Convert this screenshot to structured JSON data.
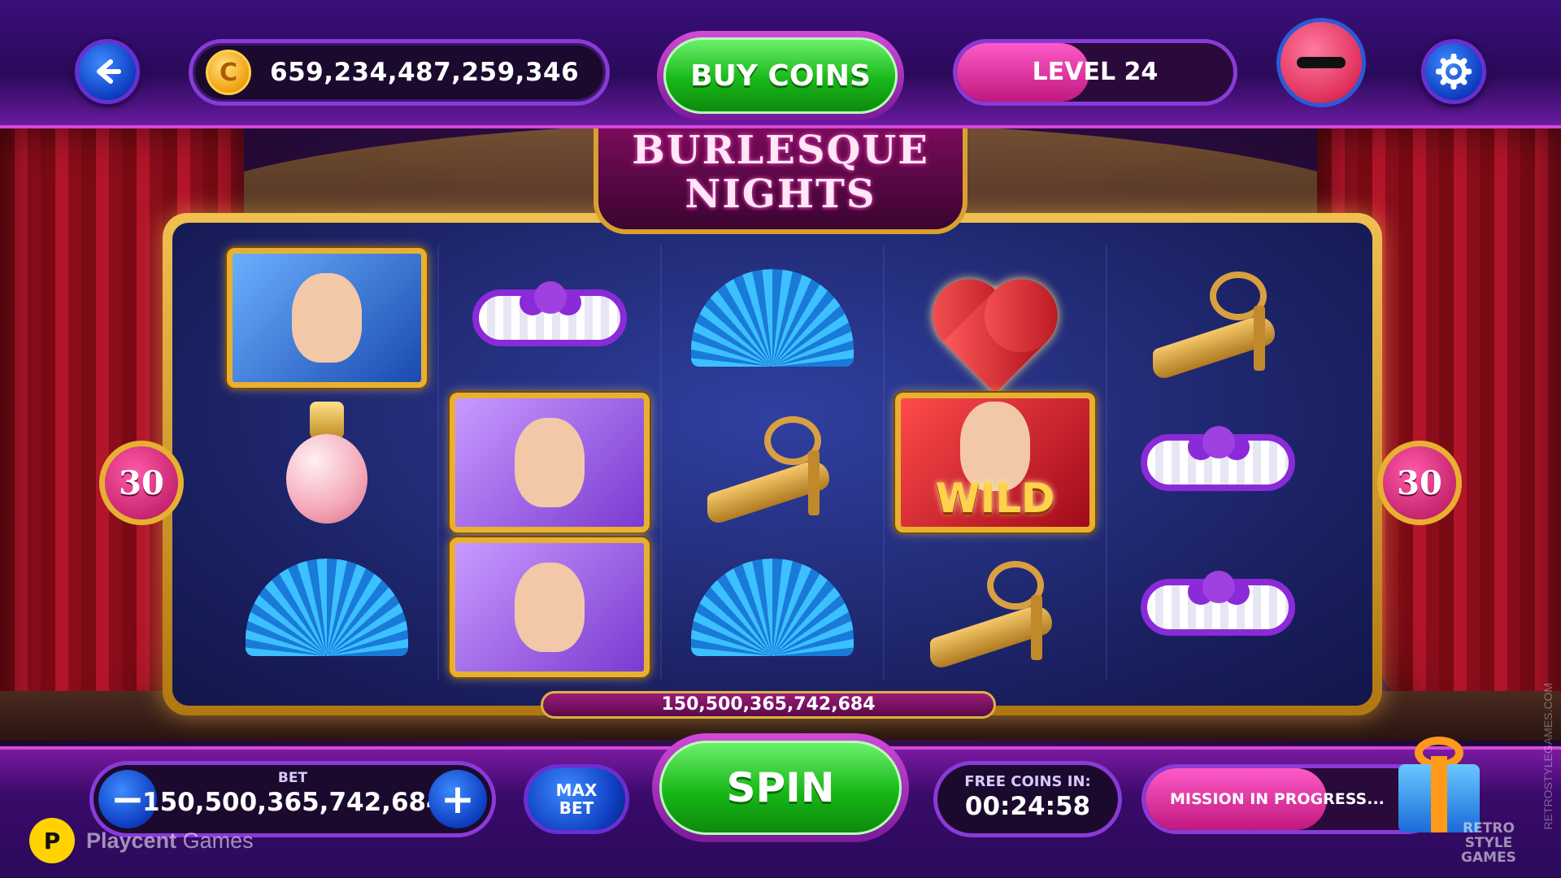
{
  "header": {
    "back_icon": "arrow-left-icon",
    "coin_symbol": "C",
    "coin_balance": "659,234,487,259,346",
    "buy_coins_label": "BUY COINS",
    "level_label": "LEVEL 24",
    "level_progress": 0.48,
    "piggy_icon": "piggy-bank-icon",
    "settings_icon": "gear-icon"
  },
  "slot": {
    "title_line1": "BURLESQUE",
    "title_line2": "NIGHTS",
    "lines_left": "30",
    "lines_right": "30",
    "total_bet_display": "150,500,365,742,684",
    "reels": [
      [
        "singer-blonde",
        "perfume",
        "fan-blue"
      ],
      [
        "garter",
        "flapper",
        "flapper"
      ],
      [
        "fan-blue",
        "shoe-gold",
        "fan-blue"
      ],
      [
        "heart-gem",
        "wild",
        "shoe-gold"
      ],
      [
        "shoe-gold",
        "garter",
        "garter"
      ]
    ],
    "wild_label": "WILD"
  },
  "footer": {
    "bet_label": "BET",
    "bet_value": "150,500,365,742,684",
    "minus_label": "−",
    "plus_label": "+",
    "max_bet_line1": "MAX",
    "max_bet_line2": "BET",
    "spin_label": "SPIN",
    "free_coins_label": "FREE COINS IN:",
    "free_coins_timer": "00:24:58",
    "mission_label": "MISSION IN PROGRESS...",
    "mission_progress": 0.62,
    "gift_icon": "gift-box-icon"
  },
  "branding": {
    "logo_letter": "P",
    "brand_name_bold": "Playcent",
    "brand_name_rest": " Games",
    "watermark_line1": "RETRO",
    "watermark_line2": "STYLE",
    "watermark_line3": "GAMES",
    "vertical_watermark": "RETROSTYLEGAMES.COM"
  },
  "colors": {
    "accent_purple": "#8a3ad8",
    "spin_green": "#18b818",
    "gold_frame": "#e8b030",
    "level_pink": "#ff5ac8"
  }
}
